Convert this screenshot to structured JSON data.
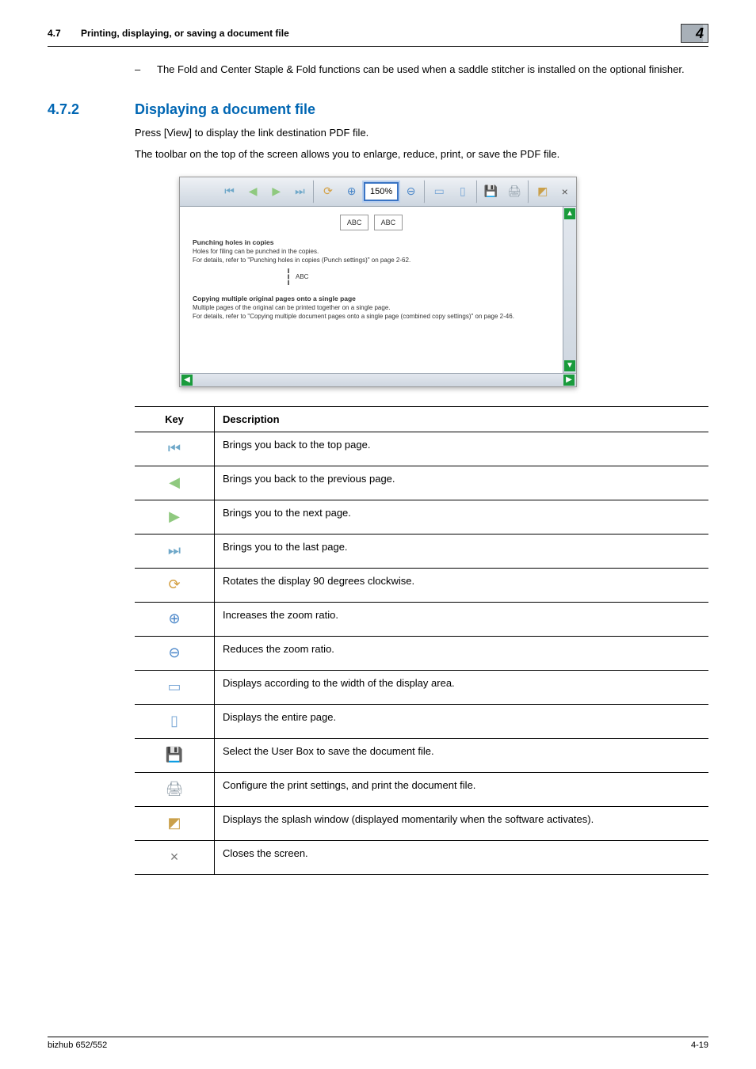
{
  "header": {
    "section_no": "4.7",
    "section_title": "Printing, displaying, or saving a document file",
    "chapter_badge": "4"
  },
  "bullet_note": "The Fold and Center Staple & Fold functions can be used when a saddle stitcher is installed on the optional finisher.",
  "subsection": {
    "number": "4.7.2",
    "title": "Displaying a document file"
  },
  "para1": "Press [View] to display the link destination PDF file.",
  "para2": "The toolbar on the top of the screen allows you to enlarge, reduce, print, or save the PDF file.",
  "viewer": {
    "zoom_value": "150%",
    "sample_abc": "ABC",
    "doc": {
      "h1": "Punching holes in copies",
      "p1": "Holes for filing can be punched in the copies.",
      "p2": "For details, refer to \"Punching holes in copies (Punch settings)\" on page 2-62.",
      "abc_small": "ABC",
      "h2": "Copying multiple original pages onto a single page",
      "p3": "Multiple pages of the original can be printed together on a single page.",
      "p4": "For details, refer to \"Copying multiple document pages onto a single page (combined copy settings)\" on page 2-46."
    }
  },
  "kd_headers": {
    "key": "Key",
    "desc": "Description"
  },
  "rows": [
    {
      "icon": "first-page-icon",
      "glyph": "⏮",
      "color": "#6fa8c9",
      "desc": "Brings you back to the top page."
    },
    {
      "icon": "prev-page-icon",
      "glyph": "◀",
      "color": "#8fc97f",
      "desc": "Brings you back to the previous page."
    },
    {
      "icon": "next-page-icon",
      "glyph": "▶",
      "color": "#8fc97f",
      "desc": "Brings you to the next page."
    },
    {
      "icon": "last-page-icon",
      "glyph": "⏭",
      "color": "#6fa8c9",
      "desc": "Brings you to the last page."
    },
    {
      "icon": "rotate-icon",
      "glyph": "⟳",
      "color": "#d4a043",
      "desc": "Rotates the display 90 degrees clockwise."
    },
    {
      "icon": "zoom-in-icon",
      "glyph": "⊕",
      "color": "#4b87c9",
      "desc": "Increases the zoom ratio."
    },
    {
      "icon": "zoom-out-icon",
      "glyph": "⊖",
      "color": "#4b87c9",
      "desc": "Reduces the zoom ratio."
    },
    {
      "icon": "fit-width-icon",
      "glyph": "▭",
      "color": "#7aa7d6",
      "desc": "Displays according to the width of the display area."
    },
    {
      "icon": "fit-page-icon",
      "glyph": "▯",
      "color": "#7aa7d6",
      "desc": "Displays the entire page."
    },
    {
      "icon": "save-icon",
      "glyph": "💾",
      "color": "#2e7bd1",
      "desc": "Select the User Box to save the document file."
    },
    {
      "icon": "print-icon",
      "glyph": "🖨",
      "color": "#8d9aa5",
      "desc": "Configure the print settings, and print the document file."
    },
    {
      "icon": "splash-icon",
      "glyph": "◩",
      "color": "#caa04a",
      "desc": "Displays the splash window (displayed momentarily when the software activates)."
    },
    {
      "icon": "close-icon",
      "glyph": "×",
      "color": "#777",
      "desc": "Closes the screen."
    }
  ],
  "footer": {
    "left": "bizhub 652/552",
    "right": "4-19"
  }
}
